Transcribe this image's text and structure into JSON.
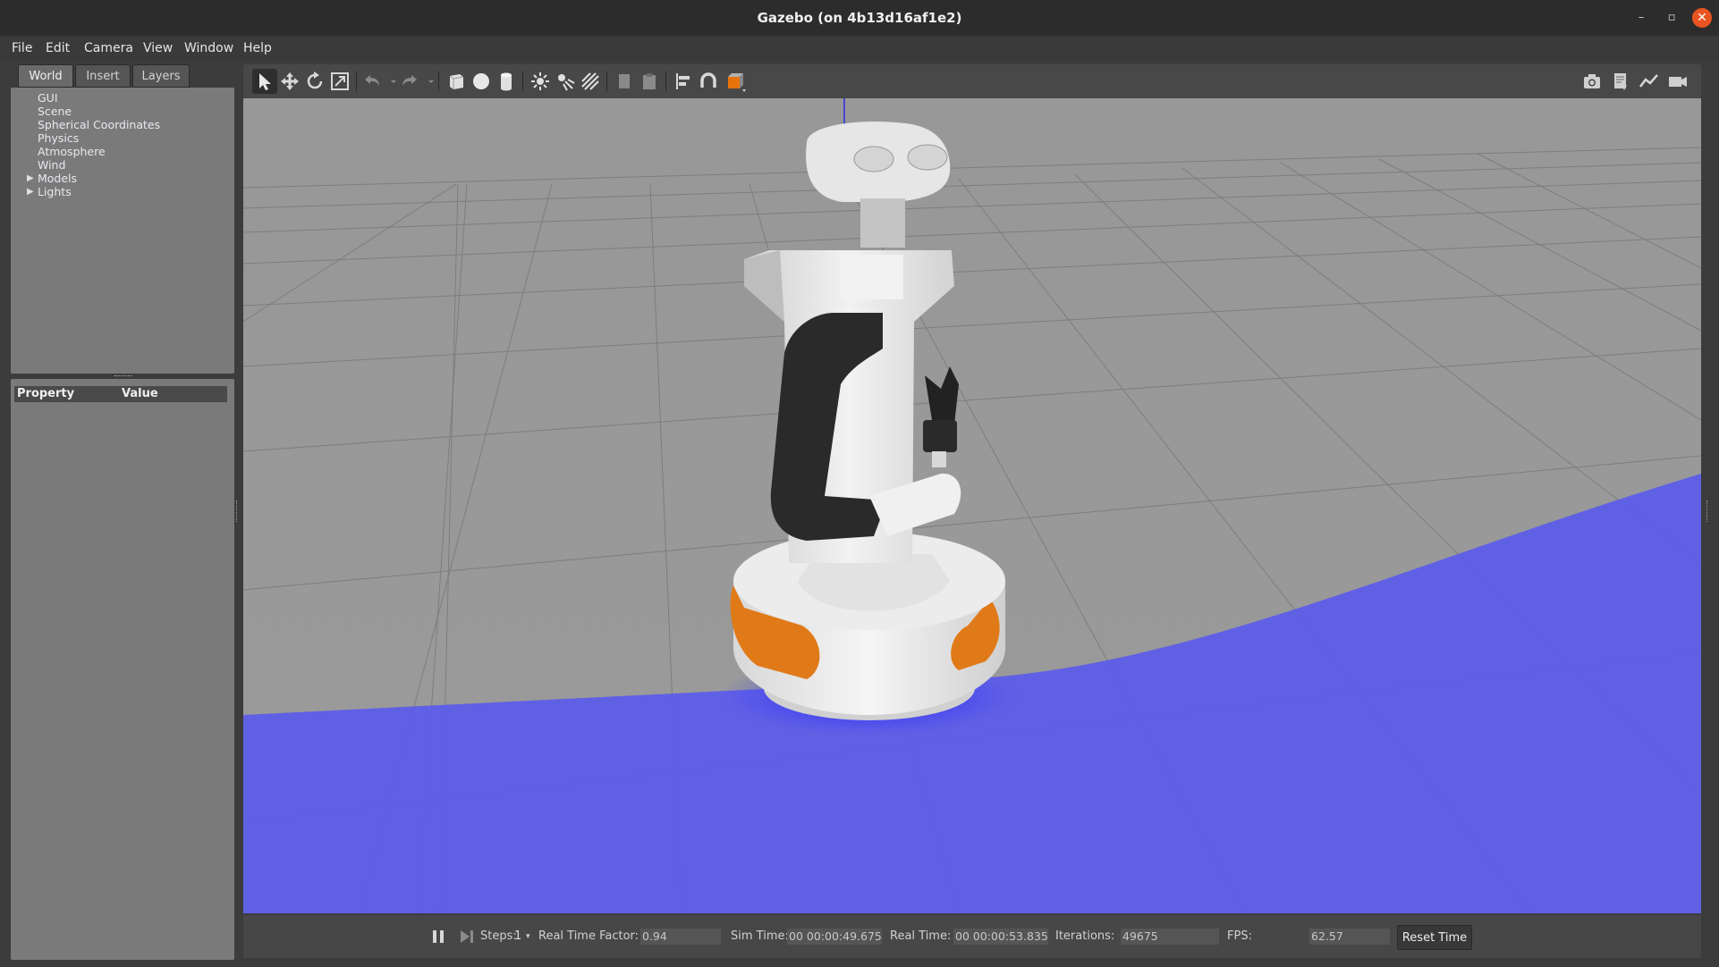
{
  "window": {
    "title": "Gazebo (on 4b13d16af1e2)",
    "controls": {
      "minimize": "–",
      "maximize": "▫",
      "close": "✕"
    }
  },
  "menubar": {
    "items": [
      {
        "label": "File",
        "icon": ""
      },
      {
        "label": "Edit"
      },
      {
        "label": "Camera"
      },
      {
        "label": "View"
      },
      {
        "label": "Window"
      },
      {
        "label": "Help"
      }
    ]
  },
  "left_panel": {
    "tabs": [
      {
        "label": "World",
        "active": true
      },
      {
        "label": "Insert",
        "active": false
      },
      {
        "label": "Layers",
        "active": false
      }
    ],
    "tree": [
      {
        "label": "GUI"
      },
      {
        "label": "Scene"
      },
      {
        "label": "Spherical Coordinates"
      },
      {
        "label": "Physics"
      },
      {
        "label": "Atmosphere"
      },
      {
        "label": "Wind"
      },
      {
        "label": "Models",
        "expandable": true
      },
      {
        "label": "Lights",
        "expandable": true
      }
    ],
    "properties": {
      "col_property": "Property",
      "col_value": "Value"
    }
  },
  "toolbar": {
    "tools": [
      "select-mode-icon",
      "translate-mode-icon",
      "rotate-mode-icon",
      "scale-mode-icon",
      "undo-icon",
      "undo-dropdown-icon",
      "redo-icon",
      "redo-dropdown-icon",
      "box-shape-icon",
      "sphere-shape-icon",
      "cylinder-shape-icon",
      "point-light-icon",
      "spot-light-icon",
      "directional-light-icon",
      "copy-icon",
      "paste-icon",
      "align-icon",
      "snap-icon",
      "view-angle-icon",
      "screenshot-icon",
      "log-icon",
      "plot-icon",
      "video-record-icon"
    ]
  },
  "bottombar": {
    "steps_label": "Steps:",
    "steps_value": "1",
    "rtf_label": "Real Time Factor:",
    "rtf_value": "0.94",
    "sim_time_label": "Sim Time:",
    "sim_time_value": "00 00:00:49.675",
    "real_time_label": "Real Time:",
    "real_time_value": "00 00:00:53.835",
    "iterations_label": "Iterations:",
    "iterations_value": "49675",
    "fps_label": "FPS:",
    "fps_value": "62.57",
    "reset_button": "Reset Time"
  },
  "colors": {
    "laser_scan": "#4a4af0",
    "robot_orange": "#e07a18",
    "robot_dark": "#2a2a2a",
    "ground": "#a0a0a0"
  }
}
